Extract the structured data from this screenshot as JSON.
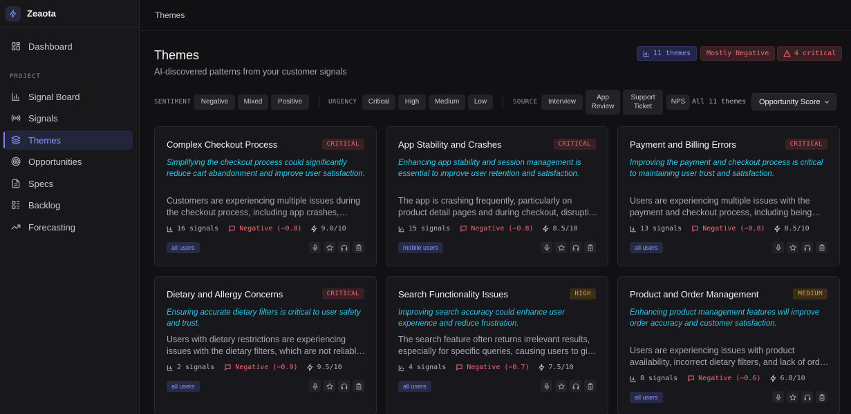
{
  "app": {
    "name": "Zeaota"
  },
  "sidebar": {
    "section_label": "PROJECT",
    "items": [
      {
        "label": "Dashboard",
        "icon": "dashboard-icon"
      },
      {
        "label": "Signal Board",
        "icon": "bar-chart-icon"
      },
      {
        "label": "Signals",
        "icon": "broadcast-icon"
      },
      {
        "label": "Themes",
        "icon": "layers-icon",
        "active": true
      },
      {
        "label": "Opportunities",
        "icon": "target-icon"
      },
      {
        "label": "Specs",
        "icon": "document-icon"
      },
      {
        "label": "Backlog",
        "icon": "backlog-icon"
      },
      {
        "label": "Forecasting",
        "icon": "trending-up-icon"
      }
    ]
  },
  "topbar": {
    "title": "Themes"
  },
  "header": {
    "title": "Themes",
    "subtitle": "AI-discovered patterns from your customer signals",
    "badges": {
      "themes": "11 themes",
      "sentiment": "Mostly Negative",
      "critical": "4 critical"
    }
  },
  "filters": {
    "sentiment_label": "SENTIMENT",
    "sentiment": [
      "Negative",
      "Mixed",
      "Positive"
    ],
    "urgency_label": "URGENCY",
    "urgency": [
      "Critical",
      "High",
      "Medium",
      "Low"
    ],
    "source_label": "SOURCE",
    "source": [
      "Interview",
      "App Review",
      "Support Ticket",
      "NPS"
    ],
    "count_text": "All 11 themes",
    "sort_value": "Opportunity Score"
  },
  "colors": {
    "accent": "#8e95ff",
    "insight": "#2fc7e6",
    "negative": "#ef6b75",
    "warning": "#e3a43b"
  },
  "cards": [
    {
      "title": "Complex Checkout Process",
      "severity": "CRITICAL",
      "insight": "Simplifying the checkout process could significantly reduce cart abandonment and improve user satisfaction.",
      "description": "Customers are experiencing multiple issues during the checkout process, including app crashes, payment failures and confusing steps.",
      "signals": "16 signals",
      "sentiment": "Negative (−0.8)",
      "score": "9.0/10",
      "segment": "all users"
    },
    {
      "title": "App Stability and Crashes",
      "severity": "CRITICAL",
      "insight": "Enhancing app stability and session management is essential to improve user retention and satisfaction.",
      "description": "The app is crashing frequently, particularly on product detail pages and during checkout, disrupting the shopping experience.",
      "signals": "15 signals",
      "sentiment": "Negative (−0.8)",
      "score": "8.5/10",
      "segment": "mobile users"
    },
    {
      "title": "Payment and Billing Errors",
      "severity": "CRITICAL",
      "insight": "Improving the payment and checkout process is critical to maintaining user trust and satisfaction.",
      "description": "Users are experiencing multiple issues with the payment and checkout process, including being charged twice.",
      "signals": "13 signals",
      "sentiment": "Negative (−0.8)",
      "score": "8.5/10",
      "segment": "all users"
    },
    {
      "title": "Dietary and Allergy Concerns",
      "severity": "CRITICAL",
      "insight": "Ensuring accurate dietary filters is critical to user safety and trust.",
      "description": "Users with dietary restrictions are experiencing issues with the dietary filters, which are not reliable enough.",
      "signals": "2 signals",
      "sentiment": "Negative (−0.9)",
      "score": "9.5/10",
      "segment": "all users"
    },
    {
      "title": "Search Functionality Issues",
      "severity": "HIGH",
      "insight": "Improving search accuracy could enhance user experience and reduce frustration.",
      "description": "The search feature often returns irrelevant results, especially for specific queries, causing users to give up.",
      "signals": "4 signals",
      "sentiment": "Negative (−0.7)",
      "score": "7.5/10",
      "segment": "all users"
    },
    {
      "title": "Product and Order Management",
      "severity": "MEDIUM",
      "insight": "Enhancing product management features will improve order accuracy and customer satisfaction.",
      "description": "Users are experiencing issues with product availability, incorrect dietary filters, and lack of order updates.",
      "signals": "8 signals",
      "sentiment": "Negative (−0.6)",
      "score": "6.8/10",
      "segment": "all users"
    }
  ]
}
